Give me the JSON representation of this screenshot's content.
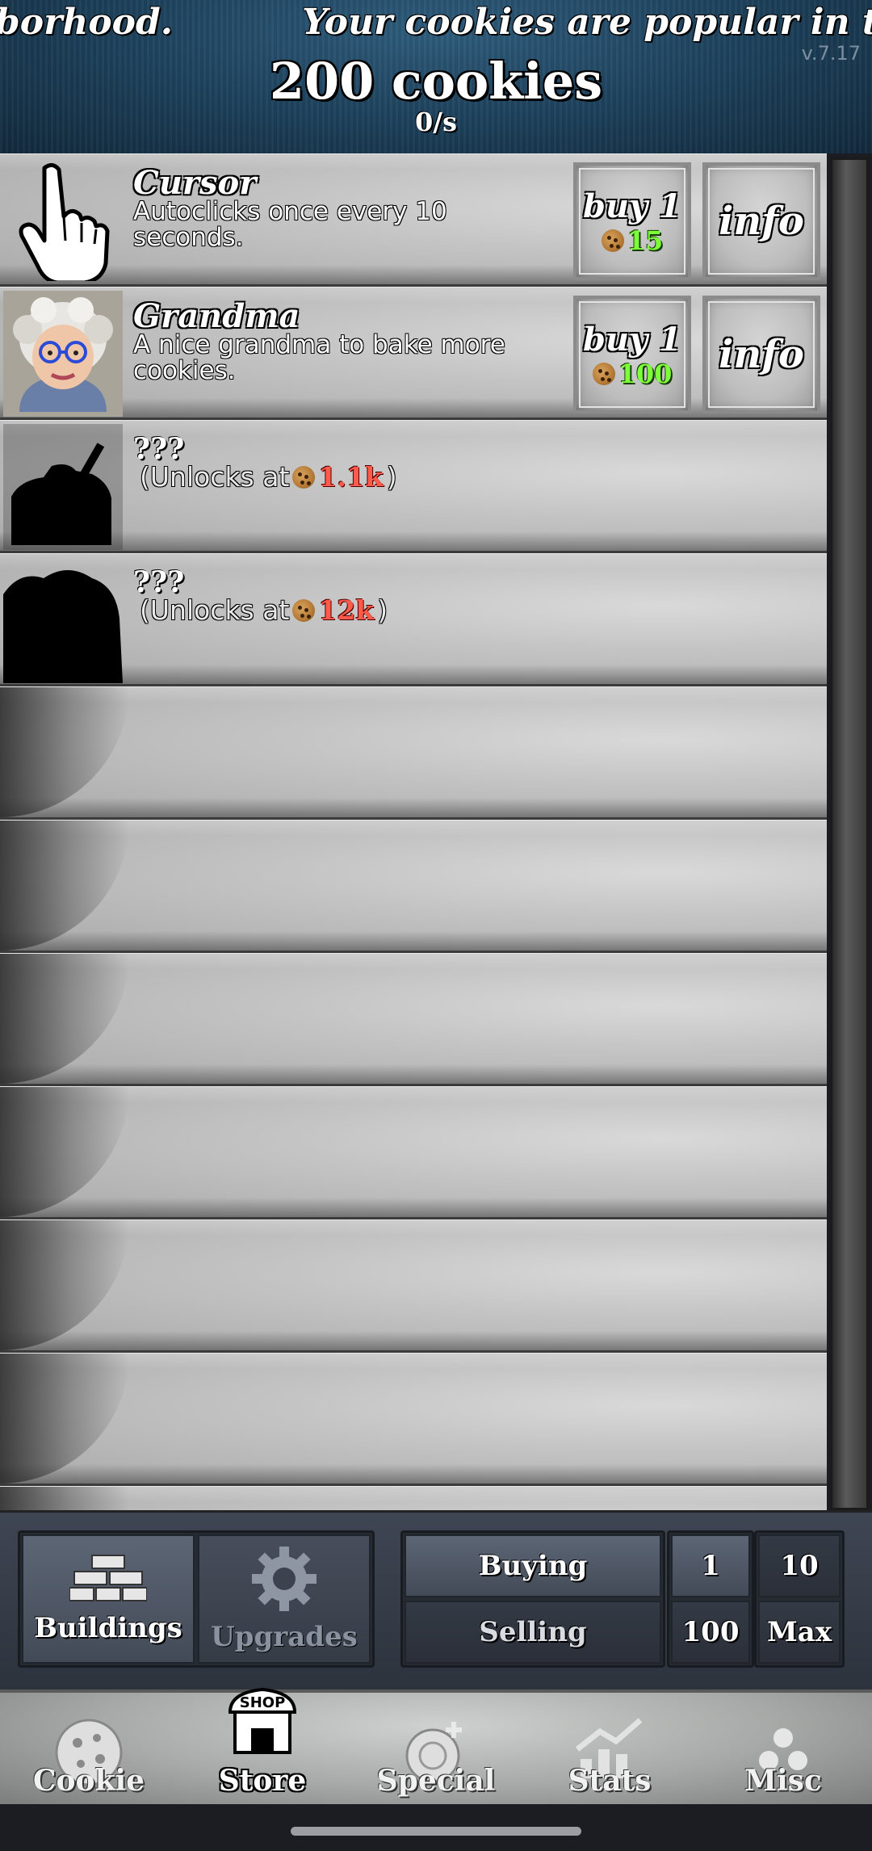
{
  "header": {
    "ticker_left": "borhood.",
    "ticker_right": "Your cookies are popular in the",
    "version": "v.7.17",
    "cookie_count": "200 cookies",
    "cps": "0/s"
  },
  "buildings": [
    {
      "name": "Cursor",
      "description": "Autoclicks once every 10 seconds.",
      "buy_label": "buy 1",
      "price": "15",
      "info_label": "info",
      "icon": "cursor-hand-icon"
    },
    {
      "name": "Grandma",
      "description": "A nice grandma to bake more cookies.",
      "buy_label": "buy 1",
      "price": "100",
      "info_label": "info",
      "icon": "grandma-portrait-icon"
    },
    {
      "name": "???",
      "unlock_text": "(Unlocks at",
      "unlock_price": "1.1k",
      "close": ")",
      "icon": "locked-farm-silhouette-icon"
    },
    {
      "name": "???",
      "unlock_text": "(Unlocks at",
      "unlock_price": "12k",
      "close": ")",
      "icon": "locked-mine-silhouette-icon"
    }
  ],
  "controls": {
    "tabs": {
      "buildings": "Buildings",
      "upgrades": "Upgrades"
    },
    "mode": {
      "buying": "Buying",
      "selling": "Selling"
    },
    "amounts": {
      "one": "1",
      "ten": "10",
      "hundred": "100",
      "max": "Max"
    }
  },
  "nav": {
    "cookie": "Cookie",
    "store": "Store",
    "store_sign": "SHOP",
    "special": "Special",
    "stats": "Stats",
    "misc": "Misc"
  },
  "colors": {
    "header_blue": "#1c3f59",
    "price_affordable": "#7dff3a",
    "price_locked": "#ff5a4a"
  }
}
